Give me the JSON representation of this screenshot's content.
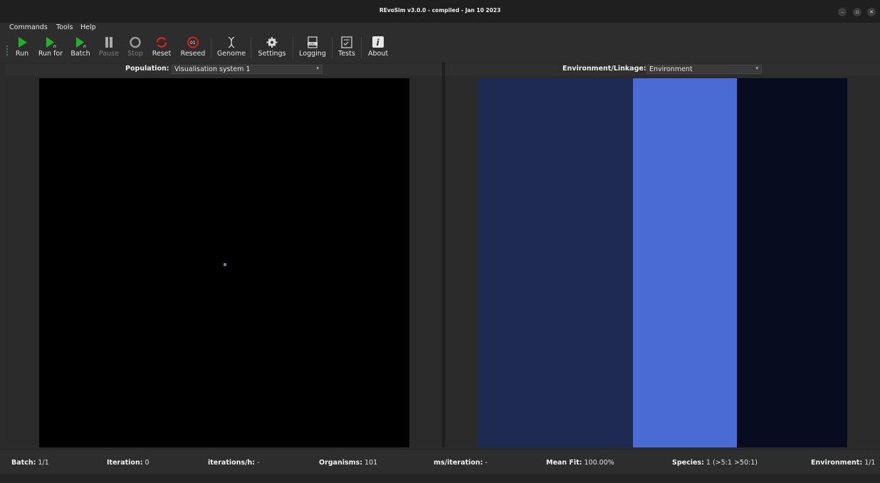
{
  "window": {
    "title": "REvoSim v3.0.0 - compiled - Jan 10 2023",
    "controls": [
      "–",
      "▫",
      "✕"
    ]
  },
  "menu": [
    "Commands",
    "Tools",
    "Help"
  ],
  "toolbar": [
    {
      "label": "Run",
      "icon": "play-icon",
      "enabled": true
    },
    {
      "label": "Run for",
      "icon": "play-n-icon",
      "enabled": true
    },
    {
      "label": "Batch",
      "icon": "batch-play-icon",
      "enabled": true
    },
    {
      "label": "Pause",
      "icon": "pause-icon",
      "enabled": false
    },
    {
      "label": "Stop",
      "icon": "stop-icon",
      "enabled": false
    },
    {
      "label": "Reset",
      "icon": "reset-icon",
      "enabled": true
    },
    {
      "label": "Reseed",
      "icon": "reseed-icon",
      "enabled": true
    },
    {
      "label": "Genome",
      "icon": "dna-icon",
      "enabled": true
    },
    {
      "label": "Settings",
      "icon": "gear-icon",
      "enabled": true
    },
    {
      "label": "Logging",
      "icon": "log-icon",
      "enabled": true
    },
    {
      "label": "Tests",
      "icon": "checklist-icon",
      "enabled": true
    },
    {
      "label": "About",
      "icon": "info-icon",
      "enabled": true
    }
  ],
  "reseed_badge": "01",
  "logging_badge": "LOG",
  "population": {
    "label": "Population:",
    "selected": "Visualisation system 1"
  },
  "environment": {
    "label": "Environment/Linkage:",
    "selected": "Environment"
  },
  "env_colors": [
    "#1e2a52",
    "#4a6ad4",
    "#070d1e"
  ],
  "organism_color": "#8a6fa6",
  "status": {
    "batch": {
      "label": "Batch:",
      "value": "1/1"
    },
    "iteration": {
      "label": "Iteration:",
      "value": "0"
    },
    "iterations_h": {
      "label": "iterations/h:",
      "value": "-"
    },
    "organisms": {
      "label": "Organisms:",
      "value": "101"
    },
    "ms_iteration": {
      "label": "ms/iteration:",
      "value": "-"
    },
    "mean_fit": {
      "label": "Mean Fit:",
      "value": "100.00%"
    },
    "species": {
      "label": "Species:",
      "value": "1 (>5:1 >50:1)"
    },
    "environment": {
      "label": "Environment:",
      "value": "1/1"
    }
  }
}
